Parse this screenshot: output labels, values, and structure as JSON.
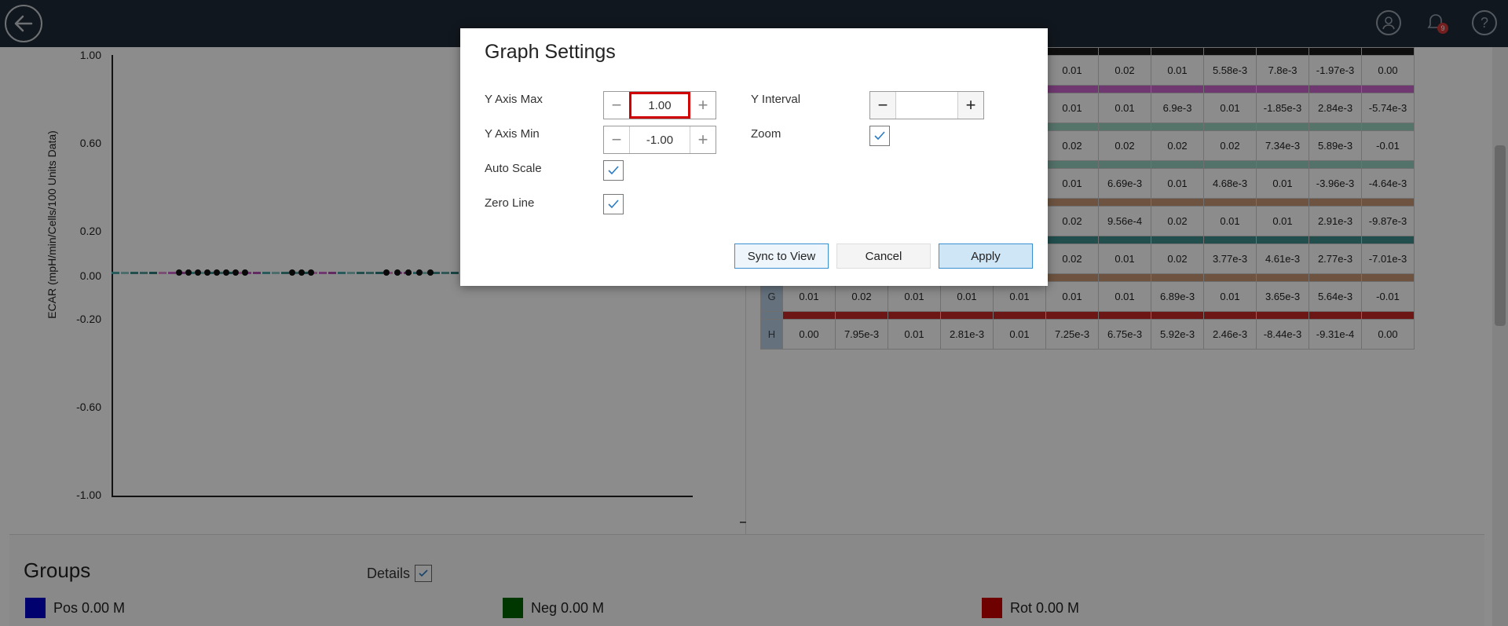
{
  "header": {
    "icons": [
      "back-arrow-icon",
      "user-icon",
      "bell-icon",
      "help-icon"
    ],
    "notification_count": "9"
  },
  "graph": {
    "ylabel": "ECAR (mpH/min/Cells/100 Units Data)",
    "ticks": [
      "1.00",
      "0.60",
      "0.20",
      "0.00",
      "-0.20",
      "-0.60",
      "-1.00"
    ]
  },
  "table": {
    "rows": [
      {
        "label": "",
        "values": [
          "",
          "",
          "",
          "",
          "0.01",
          "0.02",
          "0.01",
          "5.58e-3",
          "7.8e-3",
          "-1.97e-3",
          "0.00"
        ]
      },
      {
        "label": "",
        "values": [
          "",
          "",
          "",
          "",
          "0.01",
          "0.01",
          "6.9e-3",
          "0.01",
          "-1.85e-3",
          "2.84e-3",
          "-5.74e-3"
        ]
      },
      {
        "label": "",
        "values": [
          "",
          "",
          "",
          "",
          "0.02",
          "0.02",
          "0.02",
          "0.02",
          "7.34e-3",
          "5.89e-3",
          "-0.01"
        ]
      },
      {
        "label": "",
        "values": [
          "",
          "",
          "",
          "",
          "0.01",
          "6.69e-3",
          "0.01",
          "4.68e-3",
          "0.01",
          "-3.96e-3",
          "-4.64e-3"
        ]
      },
      {
        "label": "",
        "values": [
          "",
          "",
          "",
          "",
          "0.02",
          "9.56e-4",
          "0.02",
          "0.01",
          "0.01",
          "2.91e-3",
          "-9.87e-3"
        ]
      },
      {
        "label": "",
        "values": [
          "",
          "",
          "",
          "",
          "0.02",
          "0.01",
          "0.02",
          "3.77e-3",
          "4.61e-3",
          "2.77e-3",
          "-7.01e-3"
        ]
      },
      {
        "label": "G",
        "values": [
          "0.01",
          "0.02",
          "0.01",
          "0.01",
          "0.01",
          "0.01",
          "0.01",
          "6.89e-3",
          "0.01",
          "3.65e-3",
          "5.64e-3",
          "-0.01"
        ]
      },
      {
        "label": "H",
        "values": [
          "0.00",
          "7.95e-3",
          "0.01",
          "2.81e-3",
          "0.01",
          "7.25e-3",
          "6.75e-3",
          "5.92e-3",
          "2.46e-3",
          "-8.44e-3",
          "-9.31e-4",
          "0.00"
        ]
      }
    ]
  },
  "groups": {
    "title": "Groups",
    "details_label": "Details",
    "items": [
      {
        "name": "Pos 0.00 M",
        "color": "#0000c8"
      },
      {
        "name": "Neg 0.00 M",
        "color": "#006400"
      },
      {
        "name": "Rot 0.00 M",
        "color": "#c80000"
      }
    ]
  },
  "dialog": {
    "title": "Graph Settings",
    "y_axis_max_label": "Y Axis Max",
    "y_axis_max_value": "1.00",
    "y_axis_min_label": "Y Axis Min",
    "y_axis_min_value": "-1.00",
    "auto_scale_label": "Auto Scale",
    "zero_line_label": "Zero Line",
    "y_interval_label": "Y Interval",
    "y_interval_value": "",
    "zoom_label": "Zoom",
    "sync_label": "Sync to View",
    "cancel_label": "Cancel",
    "apply_label": "Apply"
  }
}
